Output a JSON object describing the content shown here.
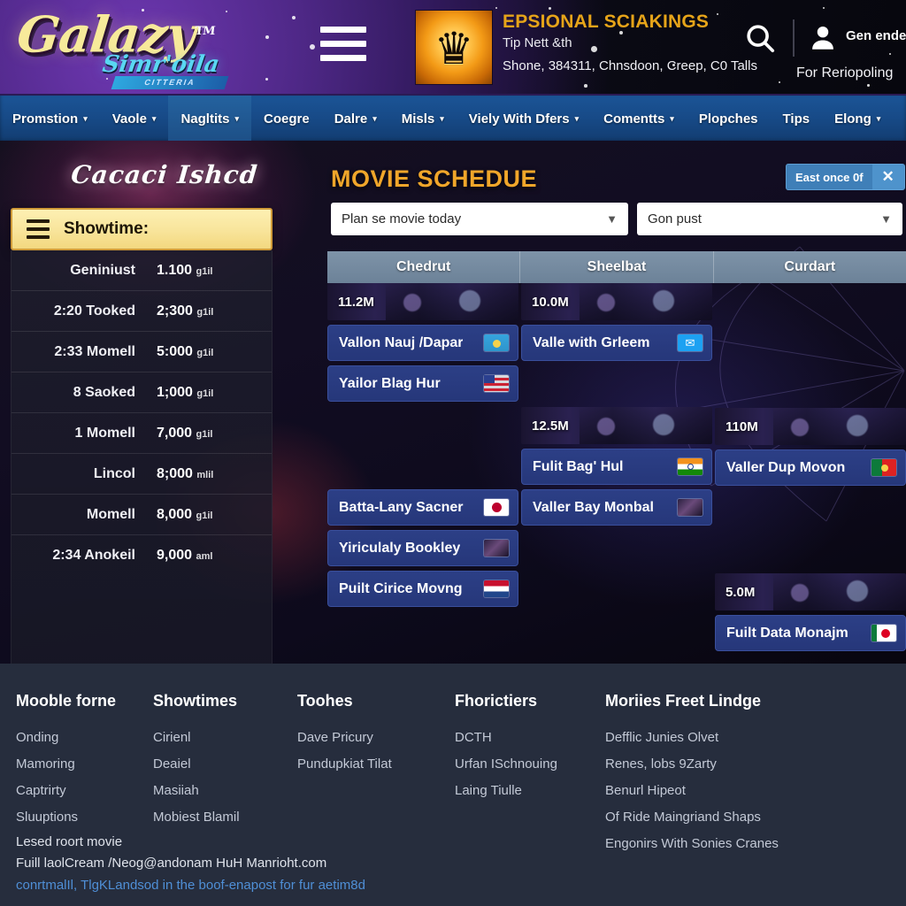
{
  "header": {
    "logo_main": "Galazy",
    "logo_tm": "TM",
    "logo_sub": "Simr'oila",
    "logo_ribbon": "CITTERIA",
    "menu_icon": "hamburger-icon",
    "crest_icon": "crown-crest-icon",
    "org_title": "EPSIONAL SCIAKINGS",
    "org_sub": "Tip Nett &th",
    "org_address": "Shone, 384311, Chnsdoon, Creep, C0 Talls",
    "search_icon": "search-icon",
    "user_icon": "user-icon",
    "account_label": "Gen ende",
    "account_sub": "For Reriopoling"
  },
  "nav": {
    "items": [
      {
        "label": "Promstion",
        "caret": "▾",
        "active": false
      },
      {
        "label": "Vaole",
        "caret": "▾",
        "active": false
      },
      {
        "label": "Nagltits",
        "caret": "▾",
        "active": true
      },
      {
        "label": "Coegre",
        "caret": "",
        "active": false
      },
      {
        "label": "Dalre",
        "caret": "▾",
        "active": false
      },
      {
        "label": "Misls",
        "caret": "▾",
        "active": false
      },
      {
        "label": "Viely With Dfers",
        "caret": "▾",
        "active": false
      },
      {
        "label": "Comentts",
        "caret": "▾",
        "active": false
      },
      {
        "label": "Plopches",
        "caret": "",
        "active": false
      },
      {
        "label": "Tips",
        "caret": "",
        "active": false
      },
      {
        "label": "Elong",
        "caret": "▾",
        "active": false
      }
    ]
  },
  "sidebar": {
    "banner_script": "Cacaci Ishcd",
    "header_icon": "hamburger-icon",
    "header_label": "Showtime:",
    "rows": [
      {
        "name": "Geniniust",
        "value": "1.100",
        "unit": "g1il"
      },
      {
        "name": "2:20 Tooked",
        "value": "2;300",
        "unit": "g1il"
      },
      {
        "name": "2:33 Momell",
        "value": "5:000",
        "unit": "g1il"
      },
      {
        "name": "8 Saoked",
        "value": "1;000",
        "unit": "g1il"
      },
      {
        "name": "1 Momell",
        "value": "7,000",
        "unit": "g1il"
      },
      {
        "name": "Lincol",
        "value": "8;000",
        "unit": "mlil"
      },
      {
        "name": "Momell",
        "value": "8,000",
        "unit": "g1il"
      },
      {
        "name": "2:34 Anokeil",
        "value": "9,000",
        "unit": "aml"
      }
    ]
  },
  "main": {
    "title": "MOVIE SCHEDUE",
    "pill_label": "East once 0f",
    "pill_close_icon": "close-icon",
    "select_date": {
      "value": "Plan se movie today",
      "placeholder": "Plan se movie today",
      "chevron_icon": "chevron-down-icon"
    },
    "select_filter": {
      "value": "Gon pust",
      "placeholder": "Gon pust",
      "chevron_icon": "chevron-down-icon"
    },
    "columns": [
      "Chedrut",
      "Sheelbat",
      "Curdart"
    ],
    "grid": [
      {
        "column": "Chedrut",
        "blocks": [
          {
            "type": "poster",
            "value": "11.2M"
          },
          {
            "type": "card",
            "name": "Vallon Nauj /Dapar",
            "flag": "f-kz"
          },
          {
            "type": "card",
            "name": "Yailor Blag Hur",
            "flag": "f-us"
          },
          {
            "type": "spacer"
          },
          {
            "type": "spacer"
          },
          {
            "type": "card",
            "name": "Batta-Lany Sacner",
            "flag": "f-jp2"
          },
          {
            "type": "card",
            "name": "Yiriculaly Bookley",
            "flag": "f-thumb"
          },
          {
            "type": "card",
            "name": "Puilt Cirice Movng",
            "flag": "f-nl"
          }
        ]
      },
      {
        "column": "Sheelbat",
        "blocks": [
          {
            "type": "poster",
            "value": "10.0M"
          },
          {
            "type": "card",
            "name": "Valle with Grleem",
            "flag": "f-tw"
          },
          {
            "type": "spacer"
          },
          {
            "type": "poster",
            "value": "12.5M"
          },
          {
            "type": "card",
            "name": "Fulit Bagʹ Hul",
            "flag": "f-in"
          },
          {
            "type": "card",
            "name": "Valler Bay Monbal",
            "flag": "f-thumb"
          }
        ]
      },
      {
        "column": "Curdart",
        "blocks": [
          {
            "type": "spacer"
          },
          {
            "type": "spacer"
          },
          {
            "type": "spacer"
          },
          {
            "type": "poster",
            "value": "110M"
          },
          {
            "type": "card",
            "name": "Valler Dup Movon",
            "flag": "f-pt"
          },
          {
            "type": "spacer"
          },
          {
            "type": "spacer"
          },
          {
            "type": "poster",
            "value": "5.0M"
          },
          {
            "type": "card",
            "name": "Fuilt Data Monajm",
            "flag": "f-jp"
          }
        ]
      }
    ]
  },
  "footer": {
    "columns": [
      {
        "title": "Mooble forne",
        "links": [
          "Onding",
          "Mamoring",
          "Captrirty",
          "Sluuptions"
        ]
      },
      {
        "title": "Showtimes",
        "links": [
          "Cirienl",
          "Deaiel",
          "Masiiah",
          "Mobiest Blamil"
        ]
      },
      {
        "title": "Toohes",
        "links": [
          "Dave Pricury",
          "Pundupkiat Tilat"
        ]
      },
      {
        "title": "Fhorictiers",
        "links": [
          "DCTH",
          "Urfan ISchnouing",
          "Laing Tiulle"
        ]
      },
      {
        "title": "Moriies Freet Lindge",
        "links": [
          "Defflic Junies Olvet",
          "Renes, lobs 9Zarty",
          "Benurl Hipeot",
          "Of Ride Maingriand Shaps",
          "Engonirs With Sonies Cranes"
        ]
      }
    ],
    "line1": "Lesed roort movie",
    "line2": "Fuill laolCream /Neog@andonam HuH Manrioht.com",
    "line3": "conrtmalIl, TlgKLandsod in the boof-enapost for fur aetim8d"
  },
  "colors": {
    "brand_yellow": "#f7ea9a",
    "nav_blue": "#1b5496",
    "title_orange": "#f0a62a",
    "card_blue": "#2c3f86",
    "footer_bg": "#262d3d",
    "link_blue": "#4f8fd6"
  }
}
